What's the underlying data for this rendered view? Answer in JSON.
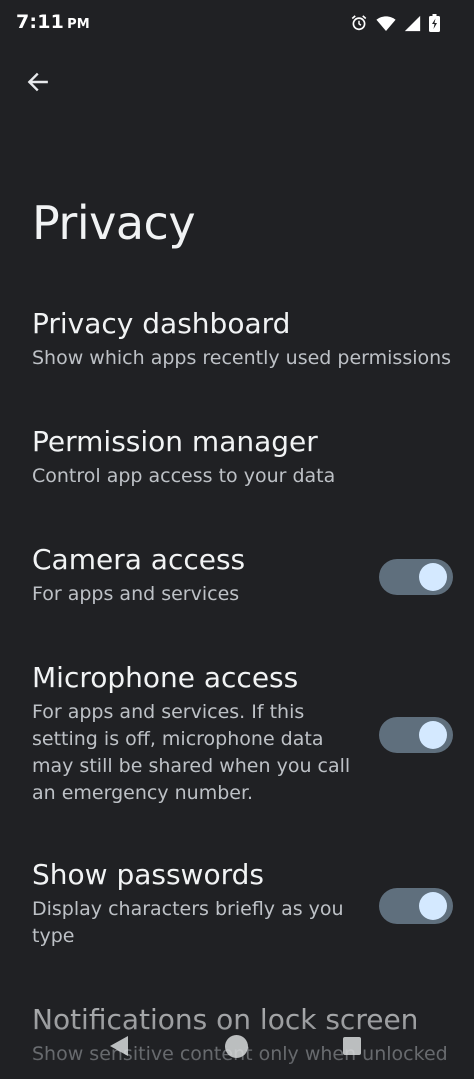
{
  "status_bar": {
    "time": "7:11",
    "ampm": "PM",
    "icons": [
      "alarm-icon",
      "wifi-icon",
      "signal-icon",
      "battery-icon"
    ]
  },
  "header": {
    "back_icon": "arrow-back-icon"
  },
  "page": {
    "title": "Privacy"
  },
  "items": [
    {
      "title": "Privacy dashboard",
      "summary": "Show which apps recently used permissions"
    },
    {
      "title": "Permission manager",
      "summary": "Control app access to your data"
    },
    {
      "title": "Camera access",
      "summary": "For apps and services",
      "toggle_on": true
    },
    {
      "title": "Microphone access",
      "summary": "For apps and services. If this setting is off, microphone data may still be shared when you call an emergency number.",
      "toggle_on": true
    },
    {
      "title": "Show passwords",
      "summary": "Display characters briefly as you type",
      "toggle_on": true
    },
    {
      "title": "Notifications on lock screen",
      "summary": "Show sensitive content only when unlocked"
    }
  ],
  "nav": {
    "icons": [
      "nav-back-icon",
      "nav-home-icon",
      "nav-recents-icon"
    ]
  },
  "colors": {
    "background": "#202124",
    "title_text": "#f1f3f4",
    "summary_text": "#bdc1c6",
    "toggle_track": "#5f6f7d",
    "toggle_thumb": "#d4e9ff"
  }
}
